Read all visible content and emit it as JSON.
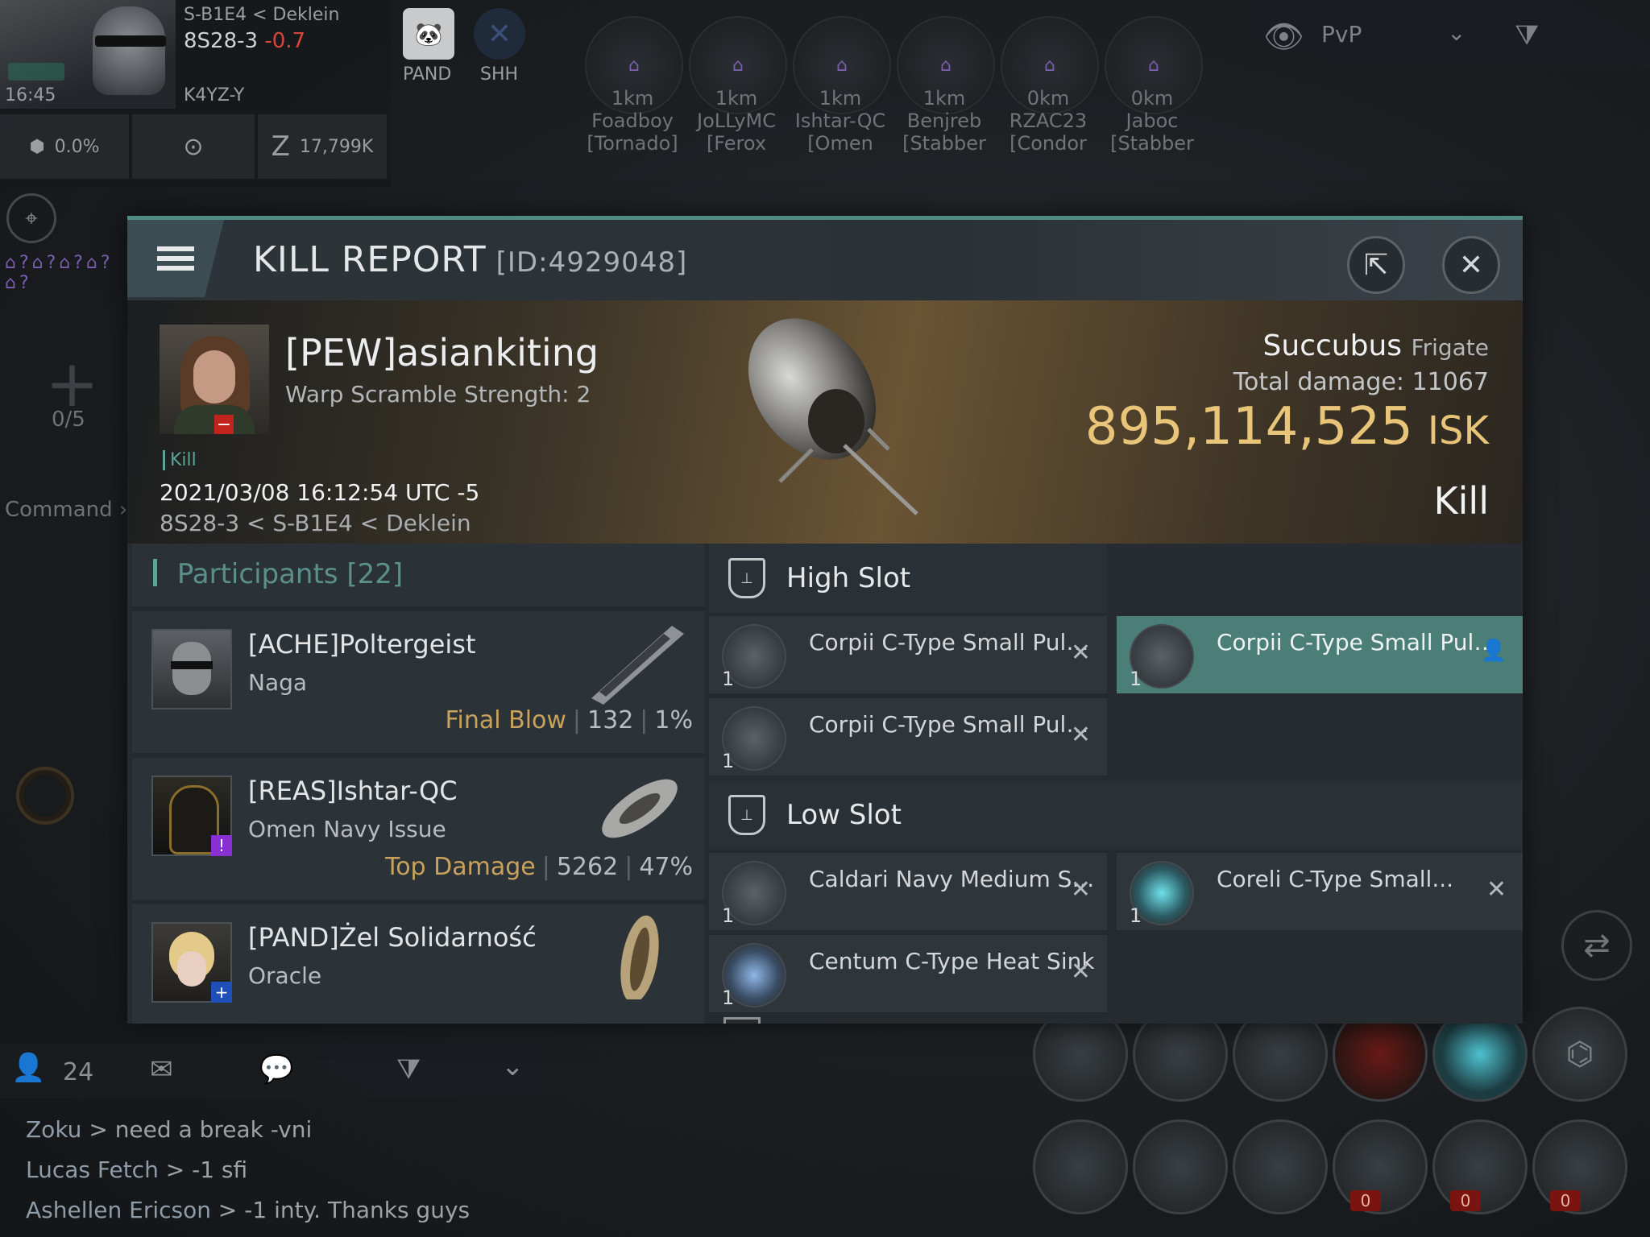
{
  "hud": {
    "system_region": "S-B1E4",
    "region": "Deklein",
    "system": "8S28-3",
    "security": "-0.7",
    "time": "16:45",
    "alliance_tag": "K4YZ-Y",
    "corp_left": "PAND",
    "corp_right": "SHH",
    "cargo_pct": "0.0%",
    "wallet": "17,799K",
    "fleet_count": "0/5",
    "command_label": "Command"
  },
  "top_right": {
    "overview_preset": "PvP"
  },
  "targets": [
    {
      "dist": "1km",
      "name": "Foadboy",
      "ship": "[Tornado]"
    },
    {
      "dist": "1km",
      "name": "JoLLyMC",
      "ship": "[Ferox"
    },
    {
      "dist": "1km",
      "name": "Ishtar-QC",
      "ship": "[Omen"
    },
    {
      "dist": "1km",
      "name": "Benjreb",
      "ship": "[Stabber"
    },
    {
      "dist": "0km",
      "name": "RZAC23",
      "ship": "[Condor"
    },
    {
      "dist": "0km",
      "name": "Jaboc",
      "ship": "[Stabber"
    }
  ],
  "kill_report": {
    "title": "KILL REPORT",
    "id": "[ID:4929048]",
    "victim": {
      "name": "[PEW]asiankiting",
      "subtitle": "Warp Scramble Strength: 2",
      "tag": "Kill",
      "datetime": "2021/03/08 16:12:54 UTC -5",
      "location": "8S28-3 < S-B1E4 < Deklein"
    },
    "ship": {
      "name": "Succubus",
      "class": "Frigate",
      "total_damage_label": "Total damage:",
      "total_damage": "11067",
      "isk_value": "895,114,525",
      "isk_unit": "ISK",
      "result": "Kill"
    },
    "participants": {
      "title": "Participants",
      "count": "[22]",
      "rows": [
        {
          "name": "[ACHE]Poltergeist",
          "ship": "Naga",
          "tag": "Final Blow",
          "damage": "132",
          "pct": "1%"
        },
        {
          "name": "[REAS]Ishtar-QC",
          "ship": "Omen Navy Issue",
          "tag": "Top Damage",
          "damage": "5262",
          "pct": "47%"
        },
        {
          "name": "[PAND]Żel Solidarność",
          "ship": "Oracle",
          "tag": "",
          "damage": "",
          "pct": ""
        }
      ]
    },
    "slots": {
      "high_label": "High Slot",
      "low_label": "Low Slot",
      "high": [
        {
          "name": "Corpii C-Type Small Pulse...",
          "qty": "1"
        },
        {
          "name": "Corpii C-Type Small Pulse...",
          "qty": "1"
        },
        {
          "name": "Corpii C-Type Small Pulse...",
          "qty": "1"
        }
      ],
      "low": [
        {
          "name": "Caldari Navy Medium Shield ...",
          "qty": "1"
        },
        {
          "name": "Coreli C-Type Small...",
          "qty": "1"
        },
        {
          "name": "Centum C-Type Heat Sink",
          "qty": "1"
        }
      ]
    }
  },
  "chat": {
    "local_count": "24",
    "lines": [
      {
        "who": "Zoku",
        "msg": "> need a break -vni"
      },
      {
        "who": "Lucas Fetch",
        "msg": "> -1 sfi"
      },
      {
        "who": "Ashellen Ericson",
        "msg": "> -1 inty. Thanks guys"
      }
    ]
  },
  "modules": {
    "overheat": [
      "0",
      "0",
      "0"
    ]
  }
}
